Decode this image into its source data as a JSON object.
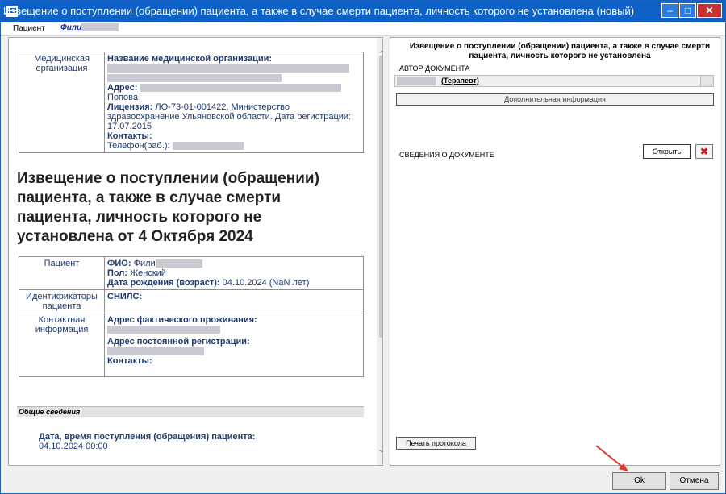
{
  "window": {
    "title": "Извещение о поступлении (обращении) пациента, а также в случае смерти пациента, личность которого не установлена (новый)",
    "min": "–",
    "max": "□",
    "close": "✕"
  },
  "patient_bar": {
    "label": "Пациент",
    "value": "Фили"
  },
  "organization": {
    "section_label": "Медицинская организация",
    "name_label": "Название медицинской организации:",
    "address_label": "Адрес:",
    "address_tail": "Попова",
    "license_label": "Лицензия:",
    "license_value": "ЛО-73-01-001422, Министерство здравоохранение Ульяновской области. Дата регистрации: 17.07.2015",
    "contacts_label": "Контакты:",
    "phone": "Телефон(раб.):"
  },
  "document_heading": "Извещение о поступлении (обращении) пациента, а также в случае смерти пациента, личность которого не установлена от 4 Октября 2024",
  "patient": {
    "section_label": "Пациент",
    "fio_label": "ФИО:",
    "fio_value": "Фили",
    "sex_label": "Пол:",
    "sex_value": "Женский",
    "dob_label": "Дата рождения (возраст):",
    "dob_value": "04.10.2024 (NaN лет)",
    "ids_label": "Идентификаторы пациента",
    "snils_label": "СНИЛС:",
    "contact_label": "Контактная информация",
    "actual_address_label": "Адрес фактического проживания:",
    "reg_address_label": "Адрес постоянной регистрации:",
    "contacts_label": "Контакты:"
  },
  "general": {
    "section_title": "Общие сведения",
    "admission_label": "Дата, время поступления (обращения) пациента:",
    "admission_value": "04.10.2024 00:00"
  },
  "right_panel": {
    "title": "Извещение о поступлении (обращении) пациента, а также в случае смерти пациента, личность которого не установлена",
    "author_label": "АВТОР ДОКУМЕНТА",
    "author_value": "(Терапевт)",
    "more_info_button": "Дополнительная информация",
    "doc_info_label": "СВЕДЕНИЯ О ДОКУМЕНТЕ",
    "open_button": "Открыть",
    "print_button": "Печать протокола"
  },
  "footer": {
    "ok": "Ok",
    "cancel": "Отмена"
  }
}
